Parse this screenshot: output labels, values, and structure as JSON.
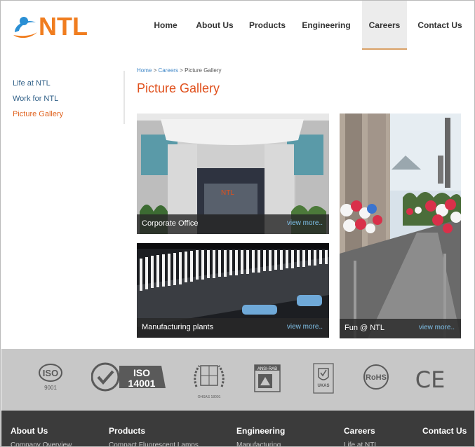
{
  "brand": {
    "name": "NTL",
    "accent": "#f07d1f",
    "swoosh": "#2a8fd4"
  },
  "nav": {
    "items": [
      {
        "label": "Home"
      },
      {
        "label": "About Us"
      },
      {
        "label": "Products"
      },
      {
        "label": "Engineering"
      },
      {
        "label": "Careers"
      },
      {
        "label": "Contact Us"
      }
    ],
    "active": "Careers"
  },
  "sidebar": {
    "items": [
      {
        "label": "Life at NTL"
      },
      {
        "label": "Work for NTL"
      },
      {
        "label": "Picture Gallery"
      }
    ],
    "active": "Picture Gallery"
  },
  "breadcrumb": {
    "home": "Home",
    "sep1": ">",
    "careers": "Careers",
    "sep2": ">",
    "current": "Picture Gallery"
  },
  "page": {
    "title": "Picture Gallery"
  },
  "gallery": [
    {
      "caption": "Corporate Office",
      "more": "view more.."
    },
    {
      "caption": "Manufacturing plants",
      "more": "view more.."
    },
    {
      "caption": "Fun @ NTL",
      "more": "view more.."
    }
  ],
  "certifications": {
    "iso9001": {
      "mark": "ISO",
      "number": "9001"
    },
    "iso14001": {
      "mark": "ISO",
      "number": "14001"
    },
    "ohsas": {
      "text": "OHSAS 18001"
    },
    "ansi": {
      "text": "ANSI-RAB"
    },
    "ukas": {
      "text": "UKAS"
    },
    "rohs": {
      "text": "RoHS"
    },
    "ce": {
      "text": "CE"
    }
  },
  "footer": {
    "columns": [
      {
        "heading": "About Us",
        "sub": "Company Overview"
      },
      {
        "heading": "Products",
        "sub": "Compact Fluorescent Lamps"
      },
      {
        "heading": "Engineering",
        "sub": "Manufacturing"
      },
      {
        "heading": "Careers",
        "sub": "Life at NTL"
      },
      {
        "heading": "Contact Us",
        "sub": ""
      }
    ]
  }
}
